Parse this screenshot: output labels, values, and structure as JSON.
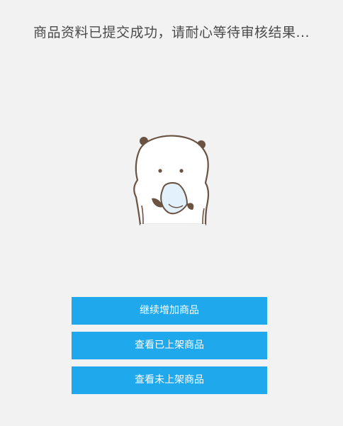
{
  "status": {
    "message": "商品资料已提交成功，请耐心等待审核结果..."
  },
  "mascot": {
    "icon": "bear-holding-tissue-icon"
  },
  "actions": {
    "add_more_label": "继续增加商品",
    "view_listed_label": "查看已上架商品",
    "view_unlisted_label": "查看未上架商品"
  },
  "colors": {
    "background": "#f2f2f2",
    "button": "#1fa8ec",
    "button_text": "#ffffff",
    "message_text": "#4a4a4a"
  }
}
